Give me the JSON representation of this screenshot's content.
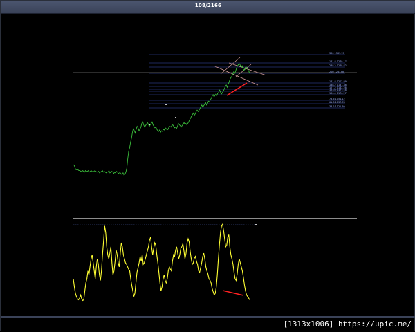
{
  "window": {
    "title": "108/2166"
  },
  "watermark": "[1313x1006] https://upic.me/",
  "colors": {
    "background": "#000000",
    "price": "#3bbf3b",
    "oscillator": "#ffff33",
    "levels": "#3c4fb8",
    "divergence": "#ff2222",
    "fan": "#d8a0a0"
  },
  "chart_data": [
    {
      "type": "line",
      "name": "price-panel",
      "series": [
        {
          "values": [
            52,
            51,
            47,
            45,
            46,
            45,
            44,
            44,
            43,
            43,
            44,
            43,
            42,
            44,
            43,
            43,
            44,
            42,
            43,
            44,
            43,
            42,
            43,
            44,
            43,
            42,
            42,
            43,
            41,
            42,
            43,
            44,
            42,
            43,
            42,
            41,
            42,
            42,
            44,
            41,
            42,
            43,
            42,
            40,
            42,
            41,
            43,
            42,
            40,
            41,
            41,
            39,
            40,
            41,
            38,
            39,
            42,
            47,
            60,
            70,
            75,
            82,
            88,
            96,
            101,
            98,
            95,
            100,
            104,
            102,
            98,
            100,
            103,
            108,
            110,
            106,
            103,
            105,
            107,
            109,
            107,
            104,
            106,
            108,
            110,
            106,
            104,
            102,
            103,
            100,
            98,
            97,
            99,
            96,
            98,
            97,
            100,
            99,
            102,
            101,
            99,
            100,
            103,
            104,
            103,
            105,
            106,
            104,
            102,
            103,
            101,
            104,
            108,
            106,
            105,
            103,
            105,
            107,
            109,
            107,
            108,
            106,
            108,
            110,
            113,
            115,
            118,
            120,
            122,
            119,
            121,
            124,
            126,
            124,
            126,
            128,
            131,
            133,
            130,
            132,
            134,
            136,
            133,
            135,
            138,
            137,
            140,
            142,
            145,
            147,
            144,
            146,
            148,
            146,
            149,
            150,
            153,
            150,
            148,
            150,
            152,
            155,
            158,
            160,
            157,
            161,
            164,
            168,
            170,
            172,
            175,
            178,
            176,
            179,
            183,
            186,
            188,
            189,
            187,
            184,
            186,
            182,
            180,
            183,
            185,
            183,
            181,
            179,
            176
          ]
        }
      ],
      "levels": [
        {
          "label": "300 1381.19"
        },
        {
          "label": "161.8 1279.17"
        },
        {
          "label": "238.2 1248.82"
        },
        {
          "label": "200 1233.66"
        },
        {
          "label": "161.8 1202.89"
        },
        {
          "label": "138.2 1187.38"
        },
        {
          "label": "127.2 1182.28"
        },
        {
          "label": "123.6 1177.18"
        },
        {
          "label": "100.0 1176.27"
        },
        {
          "label": "78.6 1151.12"
        },
        {
          "label": "61.8 1137.78"
        },
        {
          "label": "38.2 1121.69"
        }
      ]
    },
    {
      "type": "line",
      "name": "oscillator-panel",
      "series": [
        {
          "values": [
            30,
            20,
            12,
            8,
            5,
            4,
            6,
            10,
            5,
            3,
            4,
            15,
            25,
            30,
            40,
            35,
            45,
            55,
            60,
            50,
            40,
            30,
            45,
            55,
            48,
            35,
            28,
            40,
            60,
            78,
            96,
            88,
            70,
            60,
            55,
            62,
            70,
            50,
            35,
            40,
            52,
            66,
            60,
            50,
            45,
            62,
            75,
            70,
            60,
            55,
            50,
            48,
            45,
            42,
            40,
            30,
            22,
            15,
            8,
            12,
            25,
            38,
            44,
            50,
            58,
            52,
            60,
            48,
            50,
            55,
            60,
            65,
            70,
            78,
            82,
            70,
            60,
            68,
            75,
            72,
            60,
            50,
            38,
            25,
            15,
            20,
            30,
            35,
            28,
            25,
            30,
            40,
            45,
            42,
            40,
            52,
            60,
            58,
            66,
            70,
            62,
            55,
            60,
            68,
            70,
            74,
            65,
            55,
            62,
            75,
            80,
            76,
            64,
            55,
            48,
            50,
            56,
            58,
            52,
            48,
            40,
            38,
            44,
            50,
            58,
            62,
            55,
            45,
            40,
            36,
            30,
            28,
            25,
            18,
            14,
            10,
            12,
            20,
            35,
            55,
            72,
            88,
            96,
            98,
            90,
            80,
            70,
            72,
            82,
            85,
            70,
            60,
            55,
            48,
            38,
            30,
            28,
            36,
            48,
            55,
            50,
            45,
            40,
            32,
            22,
            15,
            10,
            8,
            6,
            4
          ]
        }
      ],
      "ylim": [
        0,
        100
      ]
    }
  ]
}
